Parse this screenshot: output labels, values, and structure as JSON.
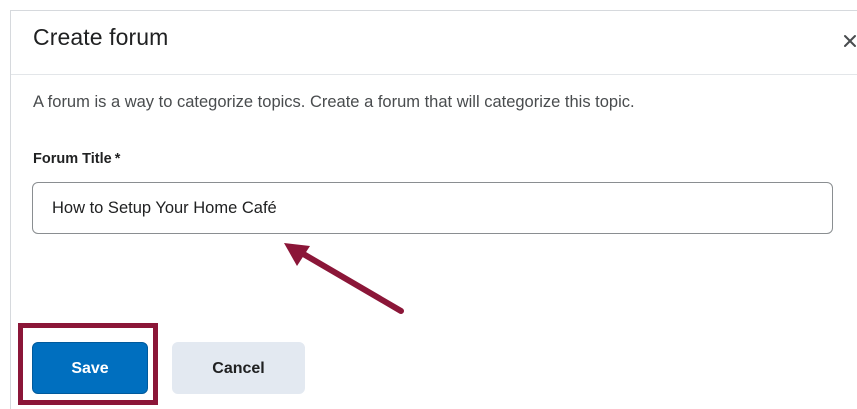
{
  "dialog": {
    "title": "Create forum",
    "close_icon": "close-icon",
    "description": "A forum is a way to categorize topics. Create a forum that will categorize this topic."
  },
  "form": {
    "forum_title_label": "Forum Title",
    "required_marker": "*",
    "forum_title_value": "How to Setup Your Home Café"
  },
  "footer": {
    "save_label": "Save",
    "cancel_label": "Cancel"
  },
  "colors": {
    "primary_button": "#006fbf",
    "secondary_button": "#e3e9f1",
    "annotation": "#8b1638"
  }
}
